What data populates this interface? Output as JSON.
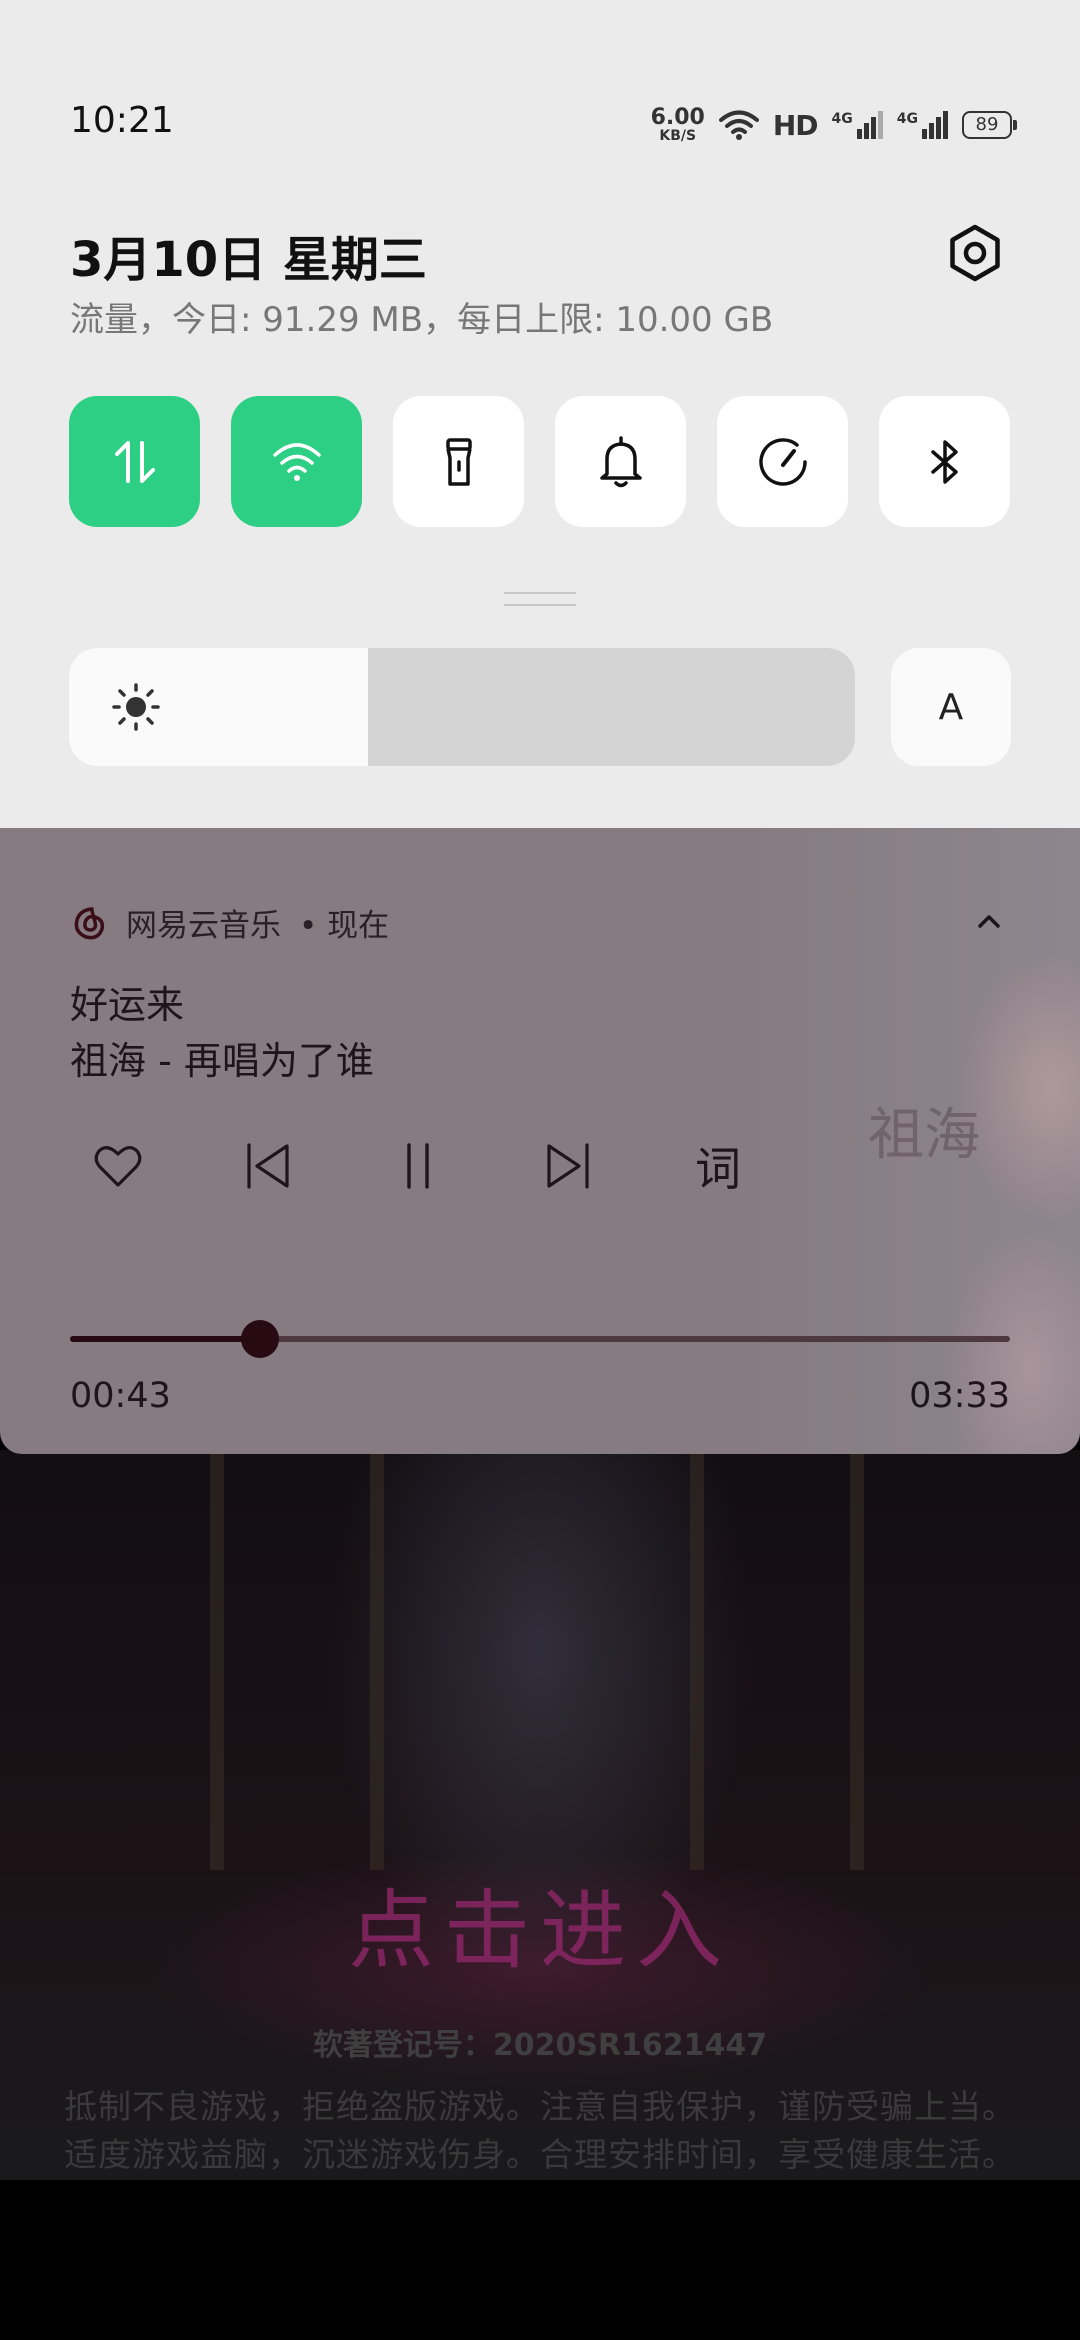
{
  "status_bar": {
    "time": "10:21",
    "net_speed_value": "6.00",
    "net_speed_unit": "KB/S",
    "hd_label": "HD",
    "signal1_label": "4G",
    "signal2_label": "4G",
    "battery": "89",
    "icons": [
      "wifi-icon",
      "hd-icon",
      "signal-icon",
      "signal-icon",
      "battery-icon"
    ]
  },
  "header": {
    "date": "3月10日  星期三",
    "data_usage": "流量，今日: 91.29 MB，每日上限: 10.00 GB",
    "settings_icon": "gear-icon"
  },
  "quick_tiles": [
    {
      "name": "mobile-data",
      "icon": "data-arrows-icon",
      "active": true
    },
    {
      "name": "wifi",
      "icon": "wifi-icon",
      "active": true
    },
    {
      "name": "flashlight",
      "icon": "flashlight-icon",
      "active": false
    },
    {
      "name": "sound",
      "icon": "bell-icon",
      "active": false
    },
    {
      "name": "performance",
      "icon": "gauge-icon",
      "active": false
    },
    {
      "name": "bluetooth",
      "icon": "bluetooth-icon",
      "active": false
    }
  ],
  "brightness": {
    "level": 0.38,
    "icon": "sun-icon",
    "auto_label": "A"
  },
  "notification": {
    "app_name": "网易云音乐",
    "time_label": "• 现在",
    "song_title": "好运来",
    "artist_line": "祖海 - 再唱为了谁",
    "album_art_text": "祖海",
    "lyric_label": "词",
    "elapsed": "00:43",
    "total": "03:33",
    "progress": 0.2019,
    "icons": [
      "netease-music-icon",
      "chevron-up-icon",
      "heart-icon",
      "previous-icon",
      "pause-icon",
      "next-icon"
    ]
  },
  "background_app": {
    "enter_text": "点击进入",
    "registration": "软著登记号：2020SR1621447",
    "warning_line1": "抵制不良游戏，拒绝盗版游戏。注意自我保护，谨防受骗上当。",
    "warning_line2": "适度游戏益脑，沉迷游戏伤身。合理安排时间，享受健康生活。"
  },
  "colors": {
    "panel_bg": "#ebebeb",
    "tile_active": "#2dcf84",
    "tile_inactive": "#ffffff",
    "notification_bg": "#857b81",
    "progress_played": "#280b12"
  }
}
